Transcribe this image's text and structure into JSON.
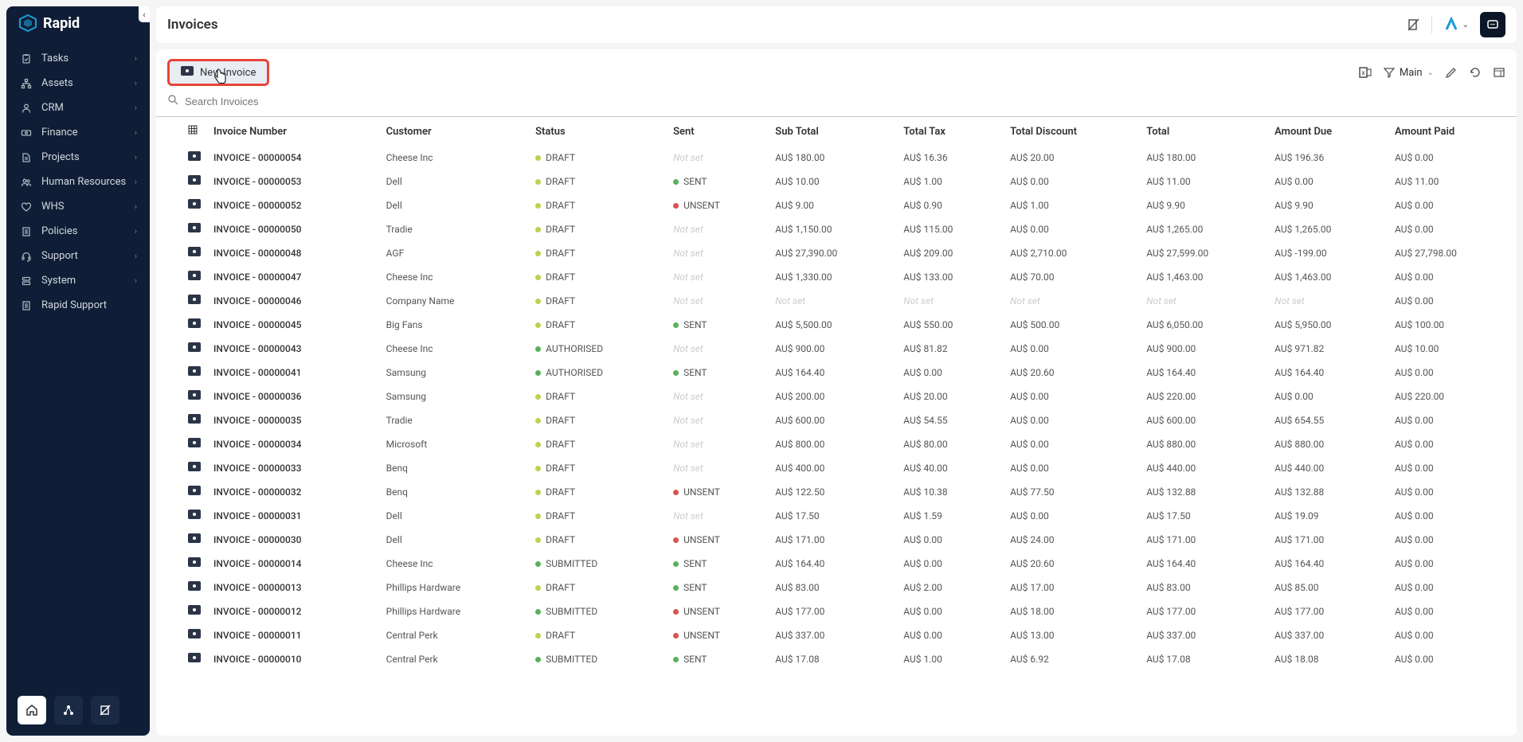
{
  "app_name": "Rapid",
  "page_title": "Invoices",
  "sidebar": {
    "items": [
      {
        "label": "Tasks",
        "has_chevron": true
      },
      {
        "label": "Assets",
        "has_chevron": true
      },
      {
        "label": "CRM",
        "has_chevron": true
      },
      {
        "label": "Finance",
        "has_chevron": true
      },
      {
        "label": "Projects",
        "has_chevron": true
      },
      {
        "label": "Human Resources",
        "has_chevron": true
      },
      {
        "label": "WHS",
        "has_chevron": true
      },
      {
        "label": "Policies",
        "has_chevron": true
      },
      {
        "label": "Support",
        "has_chevron": true
      },
      {
        "label": "System",
        "has_chevron": true
      },
      {
        "label": "Rapid Support",
        "has_chevron": false
      }
    ]
  },
  "toolbar": {
    "new_invoice_label": "New Invoice",
    "filter_label": "Main",
    "search_placeholder": "Search Invoices"
  },
  "table": {
    "columns": [
      "Invoice Number",
      "Customer",
      "Status",
      "Sent",
      "Sub Total",
      "Total Tax",
      "Total Discount",
      "Total",
      "Amount Due",
      "Amount Paid"
    ],
    "rows": [
      {
        "num": "INVOICE - 00000054",
        "cust": "Cheese Inc",
        "status": "DRAFT",
        "sent": "Not set",
        "sub": "AU$ 180.00",
        "tax": "AU$ 16.36",
        "disc": "AU$ 20.00",
        "total": "AU$ 180.00",
        "due": "AU$ 196.36",
        "paid": "AU$ 0.00"
      },
      {
        "num": "INVOICE - 00000053",
        "cust": "Dell",
        "status": "DRAFT",
        "sent": "SENT",
        "sub": "AU$ 10.00",
        "tax": "AU$ 1.00",
        "disc": "AU$ 0.00",
        "total": "AU$ 11.00",
        "due": "AU$ 0.00",
        "paid": "AU$ 11.00"
      },
      {
        "num": "INVOICE - 00000052",
        "cust": "Dell",
        "status": "DRAFT",
        "sent": "UNSENT",
        "sub": "AU$ 9.00",
        "tax": "AU$ 0.90",
        "disc": "AU$ 1.00",
        "total": "AU$ 9.90",
        "due": "AU$ 9.90",
        "paid": "AU$ 0.00"
      },
      {
        "num": "INVOICE - 00000050",
        "cust": "Tradie",
        "status": "DRAFT",
        "sent": "Not set",
        "sub": "AU$ 1,150.00",
        "tax": "AU$ 115.00",
        "disc": "AU$ 0.00",
        "total": "AU$ 1,265.00",
        "due": "AU$ 1,265.00",
        "paid": "AU$ 0.00"
      },
      {
        "num": "INVOICE - 00000048",
        "cust": "AGF",
        "status": "DRAFT",
        "sent": "Not set",
        "sub": "AU$ 27,390.00",
        "tax": "AU$ 209.00",
        "disc": "AU$ 2,710.00",
        "total": "AU$ 27,599.00",
        "due": "AU$ -199.00",
        "paid": "AU$ 27,798.00"
      },
      {
        "num": "INVOICE - 00000047",
        "cust": "Cheese Inc",
        "status": "DRAFT",
        "sent": "Not set",
        "sub": "AU$ 1,330.00",
        "tax": "AU$ 133.00",
        "disc": "AU$ 70.00",
        "total": "AU$ 1,463.00",
        "due": "AU$ 1,463.00",
        "paid": "AU$ 0.00"
      },
      {
        "num": "INVOICE - 00000046",
        "cust": "Company Name",
        "status": "DRAFT",
        "sent": "Not set",
        "sub": "Not set",
        "tax": "Not set",
        "disc": "Not set",
        "total": "Not set",
        "due": "Not set",
        "paid": "AU$ 0.00"
      },
      {
        "num": "INVOICE - 00000045",
        "cust": "Big Fans",
        "status": "DRAFT",
        "sent": "SENT",
        "sub": "AU$ 5,500.00",
        "tax": "AU$ 550.00",
        "disc": "AU$ 500.00",
        "total": "AU$ 6,050.00",
        "due": "AU$ 5,950.00",
        "paid": "AU$ 100.00"
      },
      {
        "num": "INVOICE - 00000043",
        "cust": "Cheese Inc",
        "status": "AUTHORISED",
        "sent": "Not set",
        "sub": "AU$ 900.00",
        "tax": "AU$ 81.82",
        "disc": "AU$ 0.00",
        "total": "AU$ 900.00",
        "due": "AU$ 971.82",
        "paid": "AU$ 10.00"
      },
      {
        "num": "INVOICE - 00000041",
        "cust": "Samsung",
        "status": "AUTHORISED",
        "sent": "SENT",
        "sub": "AU$ 164.40",
        "tax": "AU$ 0.00",
        "disc": "AU$ 20.60",
        "total": "AU$ 164.40",
        "due": "AU$ 164.40",
        "paid": "AU$ 0.00"
      },
      {
        "num": "INVOICE - 00000036",
        "cust": "Samsung",
        "status": "DRAFT",
        "sent": "Not set",
        "sub": "AU$ 200.00",
        "tax": "AU$ 20.00",
        "disc": "AU$ 0.00",
        "total": "AU$ 220.00",
        "due": "AU$ 0.00",
        "paid": "AU$ 220.00"
      },
      {
        "num": "INVOICE - 00000035",
        "cust": "Tradie",
        "status": "DRAFT",
        "sent": "Not set",
        "sub": "AU$ 600.00",
        "tax": "AU$ 54.55",
        "disc": "AU$ 0.00",
        "total": "AU$ 600.00",
        "due": "AU$ 654.55",
        "paid": "AU$ 0.00"
      },
      {
        "num": "INVOICE - 00000034",
        "cust": "Microsoft",
        "status": "DRAFT",
        "sent": "Not set",
        "sub": "AU$ 800.00",
        "tax": "AU$ 80.00",
        "disc": "AU$ 0.00",
        "total": "AU$ 880.00",
        "due": "AU$ 880.00",
        "paid": "AU$ 0.00"
      },
      {
        "num": "INVOICE - 00000033",
        "cust": "Benq",
        "status": "DRAFT",
        "sent": "Not set",
        "sub": "AU$ 400.00",
        "tax": "AU$ 40.00",
        "disc": "AU$ 0.00",
        "total": "AU$ 440.00",
        "due": "AU$ 440.00",
        "paid": "AU$ 0.00"
      },
      {
        "num": "INVOICE - 00000032",
        "cust": "Benq",
        "status": "DRAFT",
        "sent": "UNSENT",
        "sub": "AU$ 122.50",
        "tax": "AU$ 10.38",
        "disc": "AU$ 77.50",
        "total": "AU$ 132.88",
        "due": "AU$ 132.88",
        "paid": "AU$ 0.00"
      },
      {
        "num": "INVOICE - 00000031",
        "cust": "Dell",
        "status": "DRAFT",
        "sent": "Not set",
        "sub": "AU$ 17.50",
        "tax": "AU$ 1.59",
        "disc": "AU$ 0.00",
        "total": "AU$ 17.50",
        "due": "AU$ 19.09",
        "paid": "AU$ 0.00"
      },
      {
        "num": "INVOICE - 00000030",
        "cust": "Dell",
        "status": "DRAFT",
        "sent": "UNSENT",
        "sub": "AU$ 171.00",
        "tax": "AU$ 0.00",
        "disc": "AU$ 24.00",
        "total": "AU$ 171.00",
        "due": "AU$ 171.00",
        "paid": "AU$ 0.00"
      },
      {
        "num": "INVOICE - 00000014",
        "cust": "Cheese Inc",
        "status": "SUBMITTED",
        "sent": "SENT",
        "sub": "AU$ 164.40",
        "tax": "AU$ 0.00",
        "disc": "AU$ 20.60",
        "total": "AU$ 164.40",
        "due": "AU$ 164.40",
        "paid": "AU$ 0.00"
      },
      {
        "num": "INVOICE - 00000013",
        "cust": "Phillips Hardware",
        "status": "DRAFT",
        "sent": "SENT",
        "sub": "AU$ 83.00",
        "tax": "AU$ 2.00",
        "disc": "AU$ 17.00",
        "total": "AU$ 83.00",
        "due": "AU$ 85.00",
        "paid": "AU$ 0.00"
      },
      {
        "num": "INVOICE - 00000012",
        "cust": "Phillips Hardware",
        "status": "SUBMITTED",
        "sent": "UNSENT",
        "sub": "AU$ 177.00",
        "tax": "AU$ 0.00",
        "disc": "AU$ 18.00",
        "total": "AU$ 177.00",
        "due": "AU$ 177.00",
        "paid": "AU$ 0.00"
      },
      {
        "num": "INVOICE - 00000011",
        "cust": "Central Perk",
        "status": "DRAFT",
        "sent": "UNSENT",
        "sub": "AU$ 337.00",
        "tax": "AU$ 0.00",
        "disc": "AU$ 13.00",
        "total": "AU$ 337.00",
        "due": "AU$ 337.00",
        "paid": "AU$ 0.00"
      },
      {
        "num": "INVOICE - 00000010",
        "cust": "Central Perk",
        "status": "SUBMITTED",
        "sent": "SENT",
        "sub": "AU$ 17.08",
        "tax": "AU$ 1.00",
        "disc": "AU$ 6.92",
        "total": "AU$ 17.08",
        "due": "AU$ 18.08",
        "paid": "AU$ 0.00"
      }
    ]
  }
}
